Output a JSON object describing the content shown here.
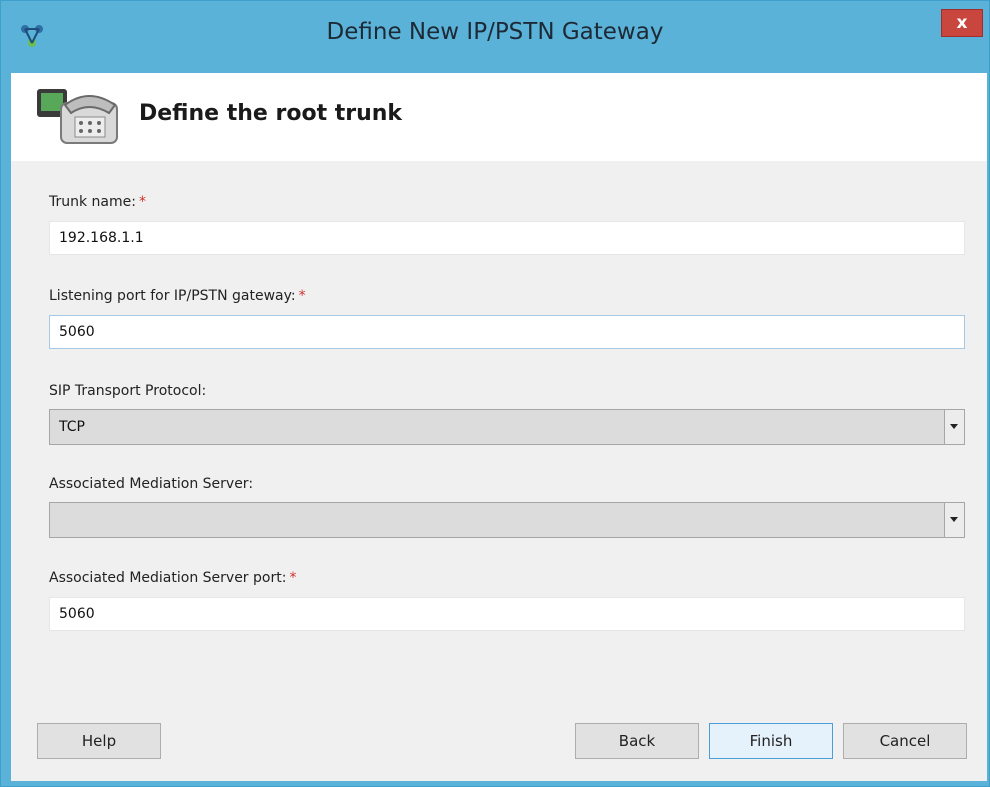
{
  "window": {
    "title": "Define New IP/PSTN Gateway",
    "close_label": "x"
  },
  "header": {
    "title": "Define the root trunk"
  },
  "form": {
    "trunk_name": {
      "label": "Trunk name:",
      "required_mark": "*",
      "value": "192.168.1.1"
    },
    "listening_port": {
      "label": "Listening port for IP/PSTN gateway:",
      "required_mark": "*",
      "value": "5060"
    },
    "sip_transport": {
      "label": "SIP Transport Protocol:",
      "value": "TCP"
    },
    "mediation_server": {
      "label": "Associated Mediation Server:",
      "value": ""
    },
    "mediation_port": {
      "label": "Associated Mediation Server port:",
      "required_mark": "*",
      "value": "5060"
    }
  },
  "buttons": {
    "help": "Help",
    "back": "Back",
    "finish": "Finish",
    "cancel": "Cancel"
  },
  "icons": {
    "app": "network-topology-icon",
    "header": "telephone-gateway-icon",
    "close": "close-icon",
    "dropdown": "chevron-down-icon"
  },
  "colors": {
    "titlebar": "#5ab2d8",
    "close_button": "#c9463f",
    "required_mark": "#d0312d",
    "dialog_background": "#f0f0f0",
    "focus_border": "#4b9fd6"
  }
}
